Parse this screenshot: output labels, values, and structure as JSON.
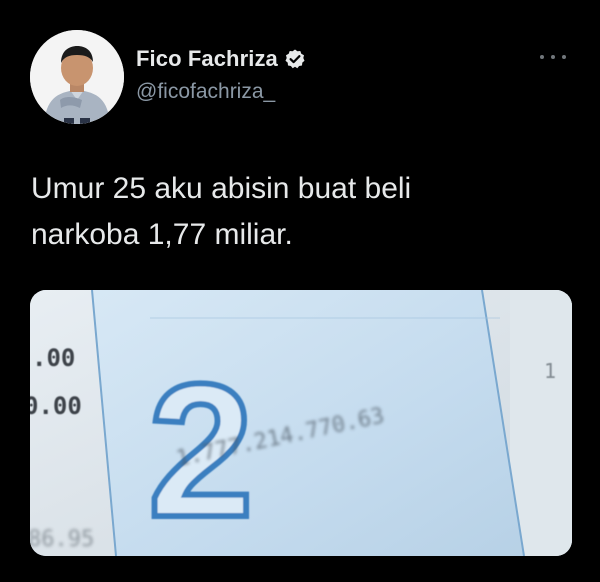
{
  "tweet": {
    "display_name": "Fico Fachriza",
    "handle": "@ficofachriza_",
    "text": "Umur 25 aku abisin buat beli\nnarkoba 1,77 miliar.",
    "verified": true,
    "more_icon": "ellipsis-icon",
    "avatar_icon": "profile-photo",
    "verified_icon": "verified-badge-icon"
  },
  "media": {
    "left_amounts": [
      ".00",
      "0.00",
      "86.95"
    ],
    "slip_digit": "2",
    "blurred_amount": "1.777.214.770.63",
    "right_digit": "1"
  },
  "colors": {
    "background": "#000000",
    "text_primary": "#e7e9ea",
    "text_secondary": "#8b98a5",
    "slip_blue": "#cfe3f1",
    "slip_ink": "#3a7fc0"
  }
}
